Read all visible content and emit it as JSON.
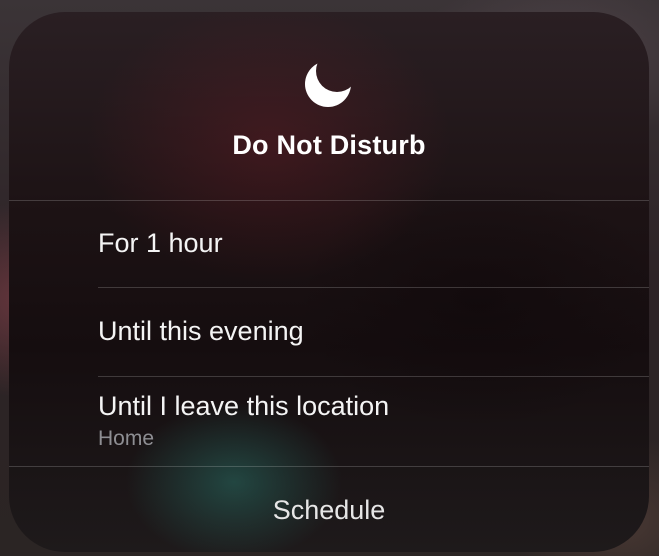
{
  "dnd_menu": {
    "icon": "moon-icon",
    "title": "Do Not Disturb",
    "options": [
      {
        "label": "For 1 hour"
      },
      {
        "label": "Until this evening"
      },
      {
        "label": "Until I leave this location",
        "sublabel": "Home"
      }
    ],
    "schedule_label": "Schedule"
  },
  "colors": {
    "text_primary": "#ffffff",
    "text_secondary": "#8e8e93"
  }
}
